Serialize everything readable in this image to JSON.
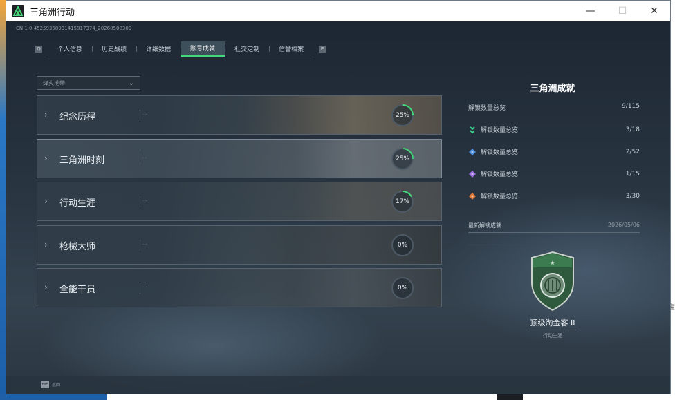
{
  "window": {
    "title": "三角洲行动"
  },
  "build_id": "CN 1.0.45259358931415817374_20260508309",
  "tabs": [
    {
      "label": "个人信息",
      "active": false
    },
    {
      "label": "历史战绩",
      "active": false
    },
    {
      "label": "详细数据",
      "active": false
    },
    {
      "label": "账号成就",
      "active": true
    },
    {
      "label": "社交定制",
      "active": false
    },
    {
      "label": "信誉档案",
      "active": false
    }
  ],
  "filter": {
    "selected": "烽火地带"
  },
  "categories": [
    {
      "label": "纪念历程",
      "progress_text": "25%",
      "progress": 0.25
    },
    {
      "label": "三角洲时刻",
      "progress_text": "25%",
      "progress": 0.25
    },
    {
      "label": "行动生涯",
      "progress_text": "17%",
      "progress": 0.17
    },
    {
      "label": "枪械大师",
      "progress_text": "0%",
      "progress": 0.0
    },
    {
      "label": "全能干员",
      "progress_text": "0%",
      "progress": 0.0
    }
  ],
  "summary": {
    "title": "三角洲成就",
    "total_label": "解锁数量总览",
    "total_value": "9/115",
    "tiers": [
      {
        "label": "解锁数量总览",
        "value": "3/18",
        "color": "#3ecf8e",
        "icon": "green-chevron-icon"
      },
      {
        "label": "解锁数量总览",
        "value": "2/52",
        "color": "#4a8fe0",
        "icon": "blue-diamond-icon"
      },
      {
        "label": "解锁数量总览",
        "value": "1/15",
        "color": "#9b6fe0",
        "icon": "purple-diamond-icon"
      },
      {
        "label": "解锁数量总览",
        "value": "3/30",
        "color": "#e07a3a",
        "icon": "orange-diamond-icon"
      }
    ],
    "recent_label": "最新解锁成就",
    "recent_date": "2026/05/06"
  },
  "badge": {
    "name": "顶级淘金客 II",
    "category": "行动生涯"
  },
  "footer": {
    "key": "Esc",
    "label": "返回"
  },
  "desktop": {
    "right_edge_text": "宝"
  },
  "colors": {
    "accent": "#44d87a",
    "ring_track": "#4d5a66"
  }
}
